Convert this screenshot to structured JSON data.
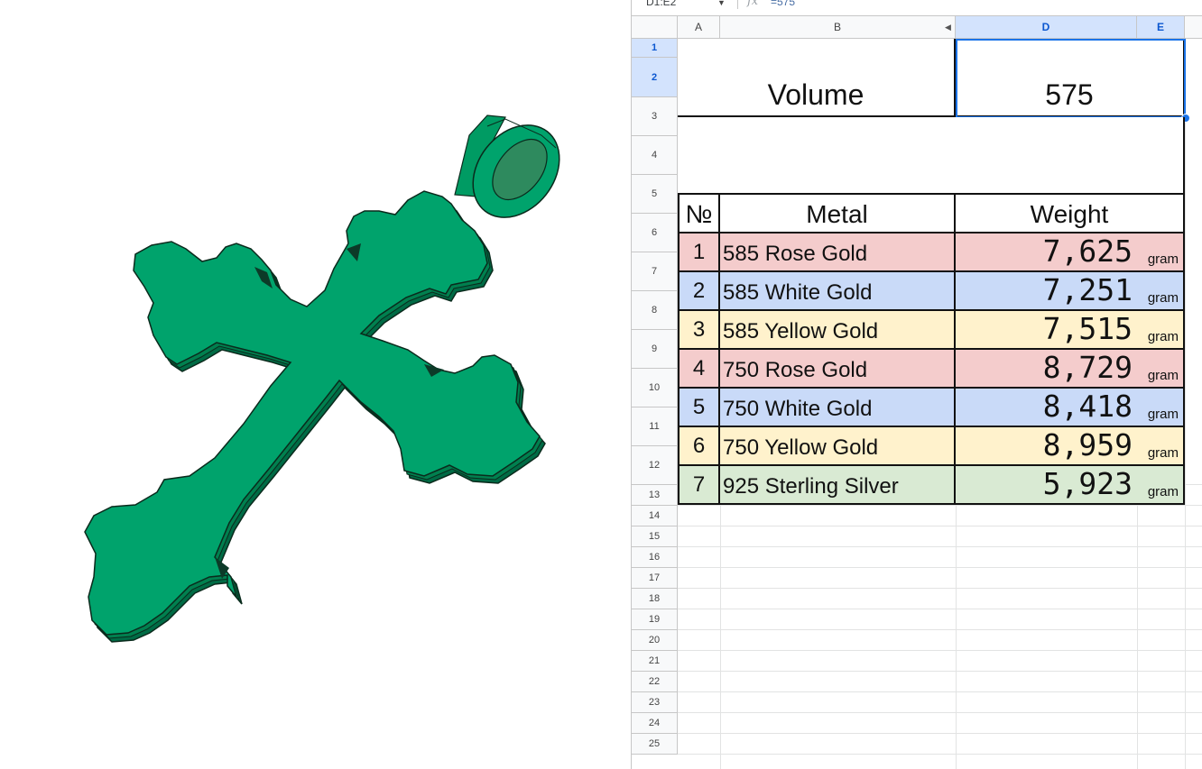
{
  "formula_bar": {
    "name_box": "D1:E2",
    "fx_icon": "function-icon",
    "formula": "=575"
  },
  "colors": {
    "rose": "#f4cccc",
    "white": "#c9daf8",
    "yellow": "#fff2cc",
    "silver": "#d9ead3",
    "model_green": "#00a36c",
    "selection": "#1a73e8"
  },
  "columns": [
    "A",
    "B",
    "D",
    "E"
  ],
  "rows": [
    "1",
    "2",
    "3",
    "4",
    "5",
    "6",
    "7",
    "8",
    "9",
    "10",
    "11",
    "12",
    "13",
    "14",
    "15",
    "16",
    "17",
    "18",
    "19",
    "20",
    "21",
    "22",
    "23",
    "24",
    "25"
  ],
  "volume": {
    "label": "Volume",
    "value": "575"
  },
  "table": {
    "headers": {
      "number": "№",
      "metal": "Metal",
      "weight": "Weight"
    },
    "rows": [
      {
        "no": "1",
        "metal": "585 Rose Gold",
        "weight": "7,625",
        "unit": "gram",
        "color": "rose"
      },
      {
        "no": "2",
        "metal": "585 White Gold",
        "weight": "7,251",
        "unit": "gram",
        "color": "white"
      },
      {
        "no": "3",
        "metal": "585 Yellow Gold",
        "weight": "7,515",
        "unit": "gram",
        "color": "yellow"
      },
      {
        "no": "4",
        "metal": "750 Rose Gold",
        "weight": "8,729",
        "unit": "gram",
        "color": "rose"
      },
      {
        "no": "5",
        "metal": "750 White Gold",
        "weight": "8,418",
        "unit": "gram",
        "color": "white"
      },
      {
        "no": "6",
        "metal": "750 Yellow Gold",
        "weight": "8,959",
        "unit": "gram",
        "color": "yellow"
      },
      {
        "no": "7",
        "metal": "925 Sterling Silver",
        "weight": "5,923",
        "unit": "gram",
        "color": "silver"
      }
    ]
  },
  "viewport": {
    "model": "cross-pendant-model"
  }
}
